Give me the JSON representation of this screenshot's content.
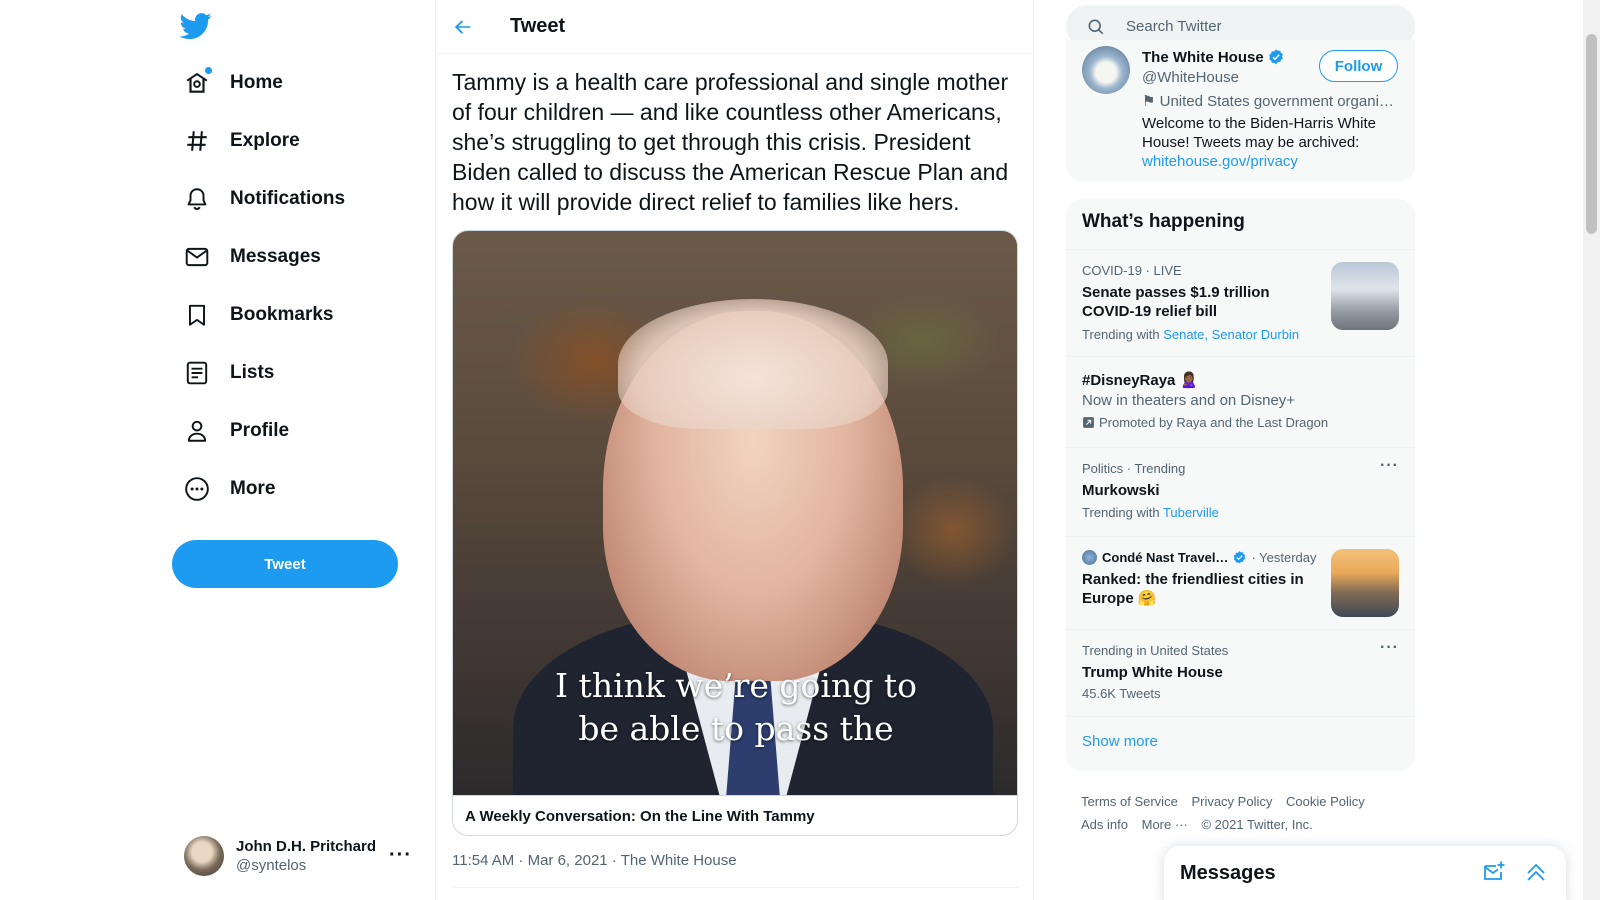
{
  "nav": {
    "items": [
      {
        "label": "Home",
        "icon": "home-icon"
      },
      {
        "label": "Explore",
        "icon": "hashtag-icon"
      },
      {
        "label": "Notifications",
        "icon": "bell-icon"
      },
      {
        "label": "Messages",
        "icon": "envelope-icon"
      },
      {
        "label": "Bookmarks",
        "icon": "bookmark-icon"
      },
      {
        "label": "Lists",
        "icon": "list-icon"
      },
      {
        "label": "Profile",
        "icon": "person-icon"
      },
      {
        "label": "More",
        "icon": "more-circle-icon"
      }
    ],
    "tweet_button": "Tweet"
  },
  "account": {
    "name": "John D.H. Pritchard",
    "handle": "@syntelos"
  },
  "header": {
    "title": "Tweet"
  },
  "tweet": {
    "text": "Tammy is a health care professional and single mother of four children — and like countless other Americans, she’s struggling to get through this crisis. President Biden called to discuss the American Rescue Plan and how it will provide direct relief to families like hers.",
    "video_caption_line1": "I think we’re going to",
    "video_caption_line2": "be able to pass the",
    "card_title": "A Weekly Conversation: On the Line With Tammy",
    "meta": "11:54 AM · Mar 6, 2021 · The White House"
  },
  "search": {
    "placeholder": "Search Twitter"
  },
  "profile": {
    "name": "The White House",
    "handle": "@WhiteHouse",
    "category": "⚑ United States government organi…",
    "bio": "Welcome to the Biden-Harris White House! Tweets may be archived:",
    "link": "whitehouse.gov/privacy",
    "follow": "Follow"
  },
  "trends": {
    "title": "What’s happening",
    "items": [
      {
        "meta": "COVID-19 · LIVE",
        "title": "Senate passes $1.9 trillion COVID-19 relief bill",
        "with_label": "Trending with",
        "with_links": "Senate, Senator Durbin"
      },
      {
        "title": "#DisneyRaya",
        "subtitle": "Now in theaters and on Disney+",
        "promo": "Promoted by Raya and the Last Dragon"
      },
      {
        "meta": "Politics · Trending",
        "title": "Murkowski",
        "with_label": "Trending with",
        "with_links": "Tuberville"
      },
      {
        "source": "Condé Nast Travel…",
        "time": "· Yesterday",
        "title": "Ranked: the friendliest cities in Europe 🤗"
      },
      {
        "meta": "Trending in United States",
        "title": "Trump White House",
        "count": "45.6K Tweets"
      }
    ],
    "show_more": "Show more"
  },
  "footer": {
    "links": [
      "Terms of Service",
      "Privacy Policy",
      "Cookie Policy",
      "Ads info",
      "More ···"
    ],
    "copyright": "© 2021 Twitter, Inc."
  },
  "messages_drawer": {
    "title": "Messages"
  },
  "colors": {
    "accent": "#1d9bf0",
    "text": "#0f1419",
    "secondary": "#536471"
  }
}
